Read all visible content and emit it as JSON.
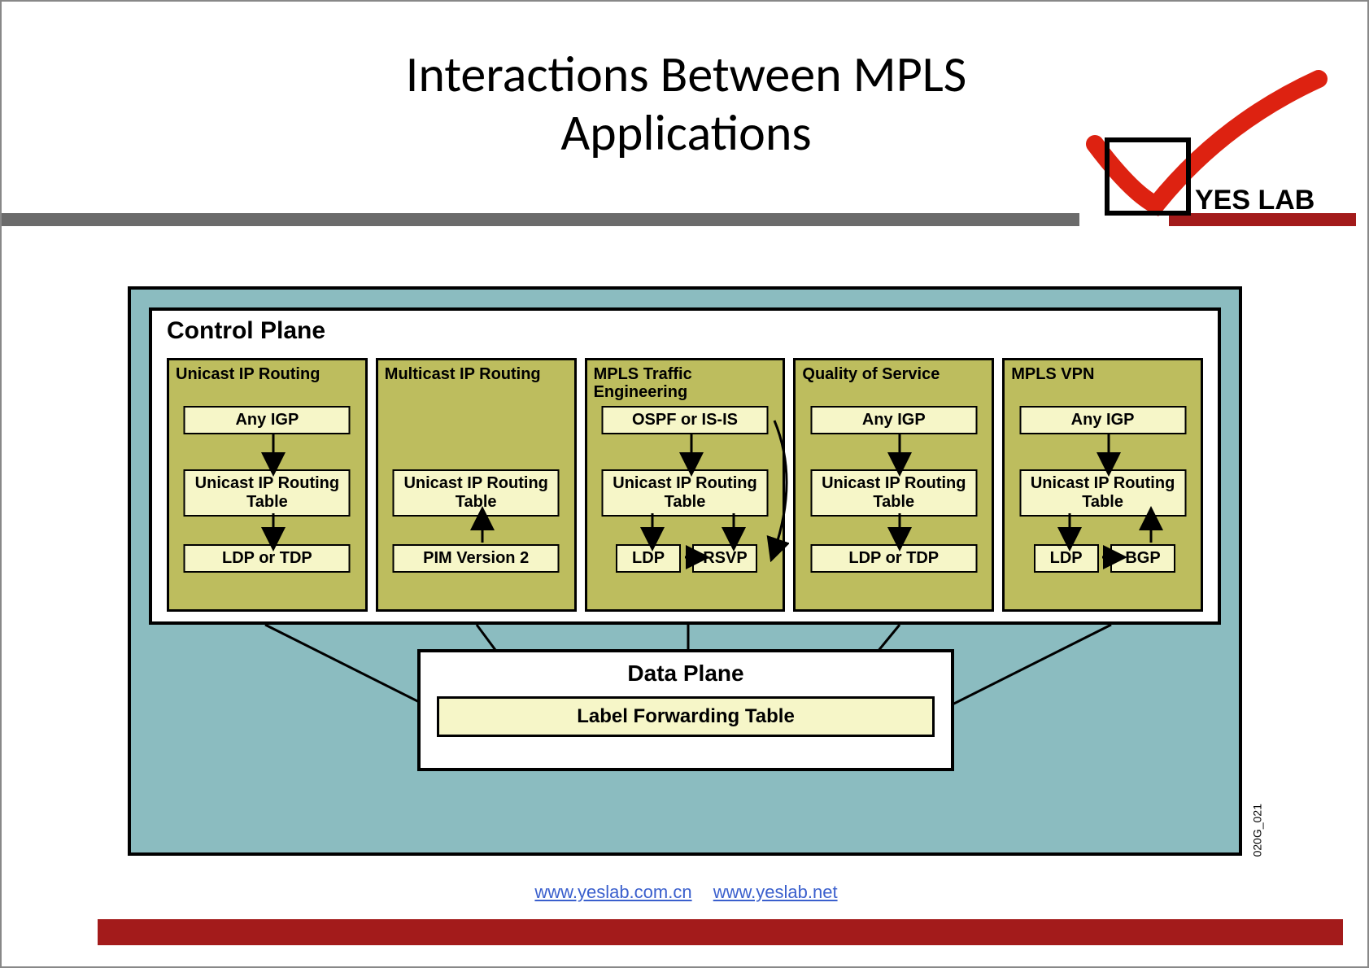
{
  "title_line1": "Interactions Between MPLS",
  "title_line2": "Applications",
  "logo_text": "YES LAB",
  "control_plane_title": "Control Plane",
  "data_plane_title": "Data Plane",
  "lft_label": "Label Forwarding Table",
  "image_ref": "020G_021",
  "footer": {
    "url1_label": "www.yeslab.com.cn",
    "url2_label": "www.yeslab.net"
  },
  "columns": [
    {
      "title": "Unicast IP Routing",
      "top": "Any IGP",
      "mid": "Unicast IP Routing Table",
      "bot": [
        "LDP or TDP"
      ]
    },
    {
      "title": "Multicast IP Routing",
      "top": "",
      "mid": "Unicast IP Routing Table",
      "bot": [
        "PIM Version 2"
      ]
    },
    {
      "title": "MPLS Traffic Engineering",
      "top": "OSPF or IS-IS",
      "mid": "Unicast IP Routing Table",
      "bot": [
        "LDP",
        "RSVP"
      ]
    },
    {
      "title": "Quality of Service",
      "top": "Any IGP",
      "mid": "Unicast IP Routing Table",
      "bot": [
        "LDP or TDP"
      ]
    },
    {
      "title": "MPLS VPN",
      "top": "Any IGP",
      "mid": "Unicast IP Routing Table",
      "bot": [
        "LDP",
        "BGP"
      ]
    }
  ]
}
